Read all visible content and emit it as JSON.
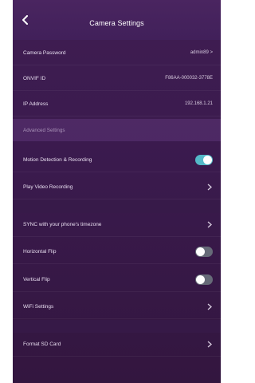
{
  "header": {
    "title": "Camera Settings"
  },
  "info_rows": [
    {
      "label": "Camera Password",
      "value": "admin89 >"
    },
    {
      "label": "ONVIF ID",
      "value": "F86AA-000032-3778E"
    },
    {
      "label": "IP Address",
      "value": "192.168.1.21"
    }
  ],
  "advanced_section": {
    "label": "Advanced Settings"
  },
  "advanced_rows": {
    "motion": {
      "label": "Motion Detection & Recording",
      "enabled": true
    },
    "playback": {
      "label": "Play Video Recording"
    }
  },
  "more_rows": {
    "sync": {
      "label": "SYNC with your phone's timezone"
    },
    "hflip": {
      "label": "Horizontal Flip",
      "enabled": false
    },
    "vflip": {
      "label": "Vertical Flip",
      "enabled": false
    },
    "wifi": {
      "label": "WiFi Settings"
    }
  },
  "format_row": {
    "label": "Format SD Card"
  },
  "icons": {
    "back": "chevron-left-icon",
    "chevron": "chevron-right-icon"
  },
  "colors": {
    "background": "#3a1a4d",
    "toggle_on": "#54b9c8",
    "toggle_off": "#666a78"
  }
}
